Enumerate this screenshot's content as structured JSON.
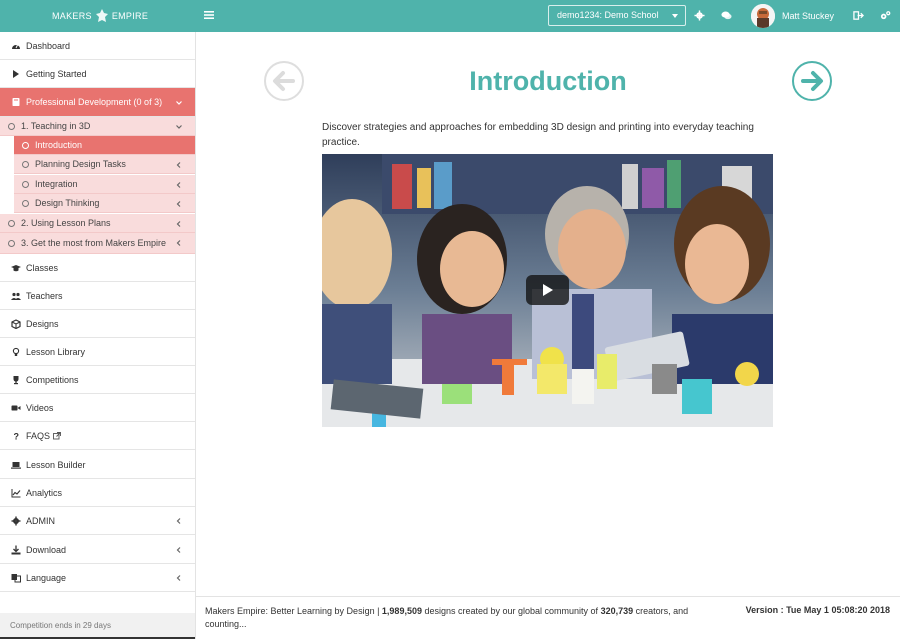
{
  "topbar": {
    "logo_text_1": "MAKERS",
    "logo_text_2": "EMPIRE",
    "school_selected": "demo1234: Demo School",
    "user_name": "Matt Stuckey",
    "icons": [
      "menu-icon",
      "gear-icon",
      "chat-icon",
      "sign-out-icon",
      "cogs-icon"
    ]
  },
  "sidebar": {
    "items": [
      {
        "label": "Dashboard",
        "icon": "tachometer-icon"
      },
      {
        "label": "Getting Started",
        "icon": "play-icon"
      },
      {
        "label": "Professional Development (0 of 3)",
        "icon": "book-icon"
      },
      {
        "label": "Classes",
        "icon": "graduation-cap-icon"
      },
      {
        "label": "Teachers",
        "icon": "users-icon"
      },
      {
        "label": "Designs",
        "icon": "cube-icon"
      },
      {
        "label": "Lesson Library",
        "icon": "lightbulb-icon"
      },
      {
        "label": "Competitions",
        "icon": "trophy-icon"
      },
      {
        "label": "Videos",
        "icon": "video-camera-icon"
      },
      {
        "label": "FAQS",
        "icon": "question-icon"
      },
      {
        "label": "Lesson Builder",
        "icon": "laptop-icon"
      },
      {
        "label": "Analytics",
        "icon": "line-chart-icon"
      },
      {
        "label": "ADMIN",
        "icon": "cog-icon"
      },
      {
        "label": "Download",
        "icon": "download-icon"
      },
      {
        "label": "Language",
        "icon": "language-icon"
      }
    ],
    "pd_sub": [
      {
        "label": "1. Teaching in 3D"
      },
      {
        "label": "Introduction"
      },
      {
        "label": "Planning Design Tasks"
      },
      {
        "label": "Integration"
      },
      {
        "label": "Design Thinking"
      },
      {
        "label": "2. Using Lesson Plans"
      },
      {
        "label": "3. Get the most from Makers Empire"
      }
    ],
    "competition_notice": "Competition ends in 29 days"
  },
  "main": {
    "title": "Introduction",
    "description": "Discover strategies and approaches for embedding 3D design and printing into everyday teaching practice."
  },
  "footer": {
    "brand": "Makers Empire: Better Learning by Design",
    "designs_count": "1,989,509",
    "text_mid": " designs created by our global community of ",
    "creators_count": "320,739",
    "text_end": " creators, and counting...",
    "version_label": "Version : ",
    "version_value": "Tue May 1 05:08:20 2018"
  },
  "colors": {
    "teal": "#4fb3ab",
    "coral": "#e8736f",
    "pink_light": "#f9dcdc"
  }
}
